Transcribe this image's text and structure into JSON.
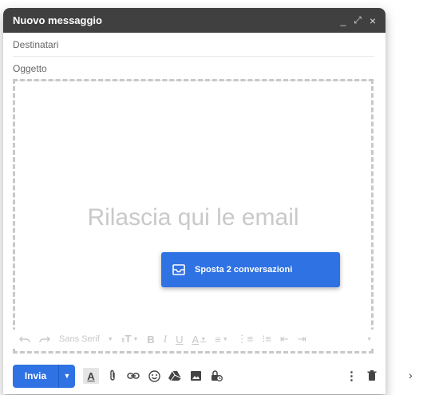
{
  "window": {
    "title": "Nuovo messaggio",
    "controls": [
      "_",
      "⤢",
      "×"
    ]
  },
  "fields": {
    "recipients_placeholder": "Destinatari",
    "subject_placeholder": "Oggetto"
  },
  "dropzone": {
    "text": "Rilascia qui le email"
  },
  "move_chip": {
    "label": "Sposta 2 conversazioni",
    "icon": "mail-icon"
  },
  "format_toolbar": {
    "font": "Sans Serif",
    "items": [
      "undo-icon",
      "redo-icon",
      "font-select",
      "text-size-icon",
      "bold-icon",
      "italic-icon",
      "underline-icon",
      "text-color-icon",
      "align-icon",
      "numbered-list-icon",
      "bulleted-list-icon",
      "indent-less-icon",
      "indent-more-icon",
      "more-formatting-icon"
    ]
  },
  "bottom_toolbar": {
    "send_label": "Invia",
    "format_letter": "A",
    "tools": [
      "format-text-icon",
      "attach-icon",
      "link-icon",
      "emoji-icon",
      "drive-icon",
      "photo-icon",
      "confidential-icon"
    ],
    "right": [
      "more-options-icon",
      "trash-icon"
    ]
  },
  "colors": {
    "titlebar": "#404040",
    "accent": "#2f72e3"
  }
}
